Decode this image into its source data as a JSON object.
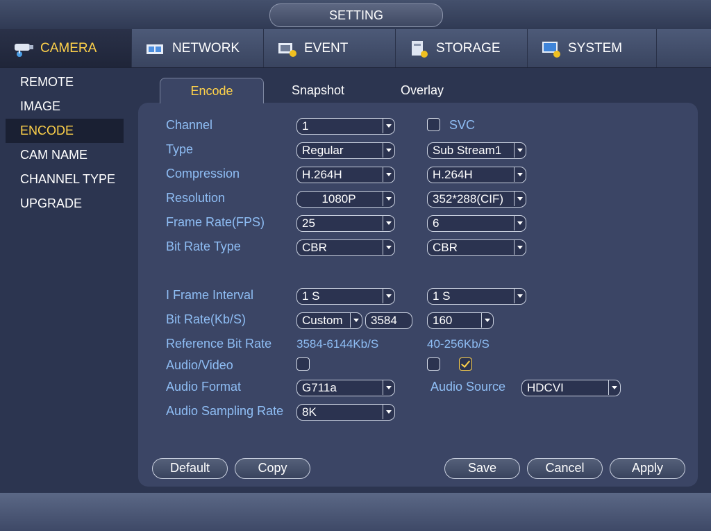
{
  "window": {
    "title": "SETTING"
  },
  "top_tabs": [
    {
      "label": "CAMERA",
      "icon": "camera-icon",
      "active": true
    },
    {
      "label": "NETWORK",
      "icon": "network-icon"
    },
    {
      "label": "EVENT",
      "icon": "event-icon"
    },
    {
      "label": "STORAGE",
      "icon": "storage-icon"
    },
    {
      "label": "SYSTEM",
      "icon": "system-icon"
    }
  ],
  "sidebar": {
    "items": [
      {
        "label": "REMOTE"
      },
      {
        "label": "IMAGE"
      },
      {
        "label": "ENCODE",
        "active": true
      },
      {
        "label": "CAM NAME"
      },
      {
        "label": "CHANNEL TYPE"
      },
      {
        "label": "UPGRADE"
      }
    ]
  },
  "sub_tabs": {
    "encode": "Encode",
    "snapshot": "Snapshot",
    "overlay": "Overlay"
  },
  "form": {
    "labels": {
      "channel": "Channel",
      "type": "Type",
      "compression": "Compression",
      "resolution": "Resolution",
      "frame_rate": "Frame Rate(FPS)",
      "bit_rate_type": "Bit Rate Type",
      "i_frame": "I Frame Interval",
      "bit_rate": "Bit Rate(Kb/S)",
      "ref_bit_rate": "Reference Bit Rate",
      "audio_video": "Audio/Video",
      "audio_format": "Audio Format",
      "audio_sampling": "Audio Sampling Rate",
      "audio_source": "Audio Source",
      "svc": "SVC"
    },
    "main": {
      "channel": "1",
      "type": "Regular",
      "compression": "H.264H",
      "resolution": "1080P",
      "frame_rate": "25",
      "bit_rate_type": "CBR",
      "i_frame": "1 S",
      "bit_rate_mode": "Custom",
      "bit_rate_value": "3584",
      "ref_bit_rate": "3584-6144Kb/S",
      "audio_video_checked": false,
      "audio_format": "G711a",
      "audio_sampling": "8K"
    },
    "sub": {
      "svc_checked": false,
      "type": "Sub Stream1",
      "compression": "H.264H",
      "resolution": "352*288(CIF)",
      "frame_rate": "6",
      "bit_rate_type": "CBR",
      "i_frame": "1 S",
      "bit_rate": "160",
      "ref_bit_rate": "40-256Kb/S",
      "audio_video_checked": false,
      "audio_video2_checked": true,
      "audio_source": "HDCVI"
    }
  },
  "buttons": {
    "default": "Default",
    "copy": "Copy",
    "save": "Save",
    "cancel": "Cancel",
    "apply": "Apply"
  },
  "colors": {
    "accent": "#ffd24a",
    "label": "#8fbef5",
    "background": "#2c3550",
    "panel": "#3b4565"
  }
}
